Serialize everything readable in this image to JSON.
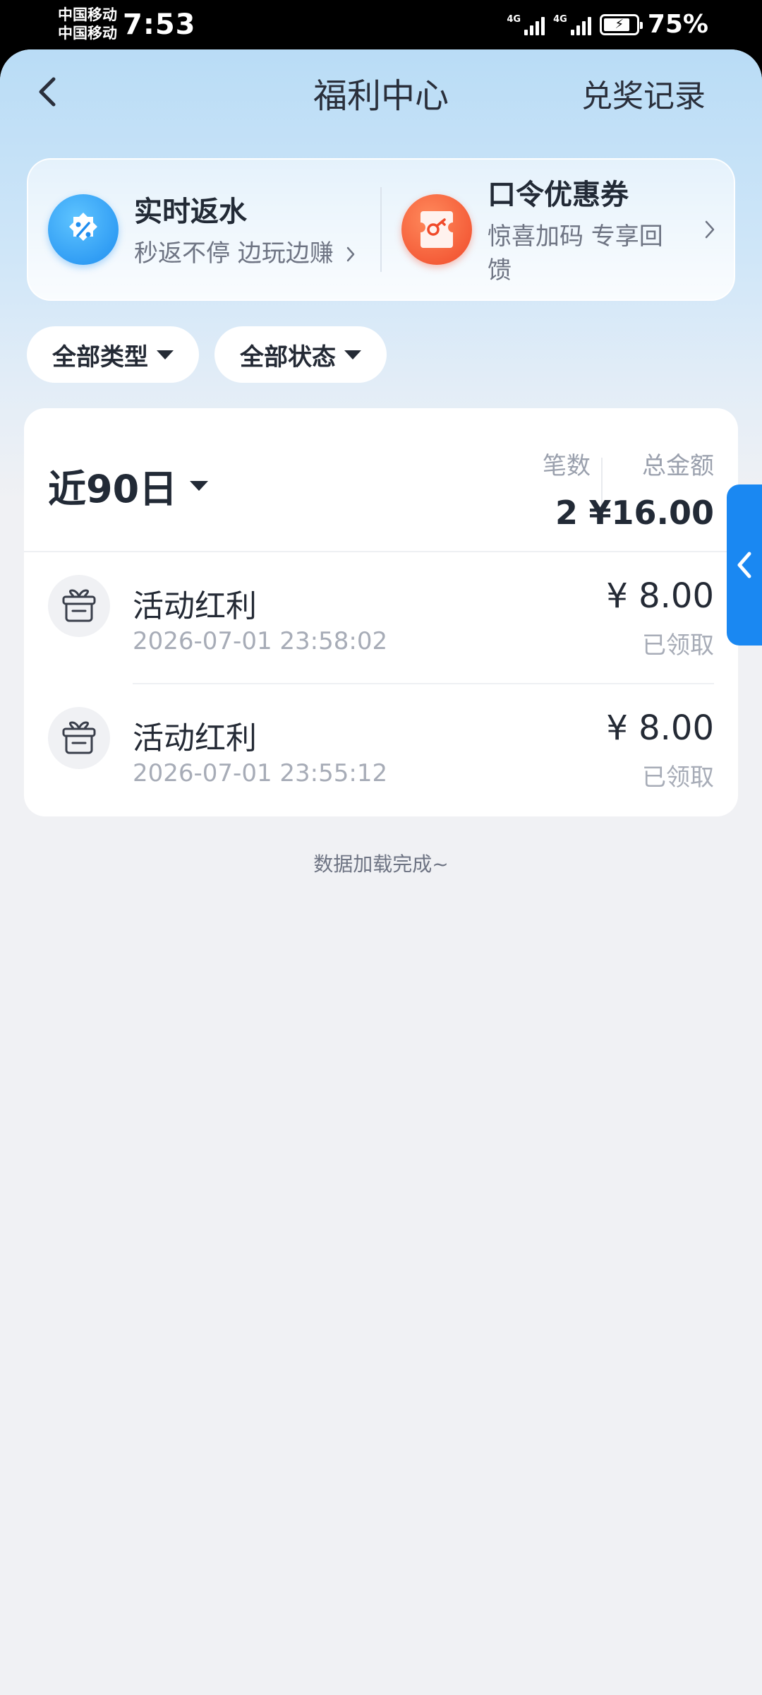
{
  "status_bar": {
    "carrier_1": "中国移动",
    "carrier_2": "中国移动",
    "time": "7:53",
    "network_1": "4G",
    "network_2": "4G",
    "battery_percent": "75%"
  },
  "header": {
    "title": "福利中心",
    "right_action": "兑奖记录"
  },
  "promos": [
    {
      "title": "实时返水",
      "subtitle": "秒返不停 边玩边赚",
      "icon": "percent-badge-icon"
    },
    {
      "title": "口令优惠券",
      "subtitle": "惊喜加码 专享回馈",
      "icon": "coupon-ticket-icon"
    }
  ],
  "filters": {
    "type": "全部类型",
    "status": "全部状态"
  },
  "summary": {
    "period": "近90日",
    "count_label": "笔数",
    "count_value": "2",
    "total_label": "总金额",
    "total_value": "¥16.00"
  },
  "records": [
    {
      "title": "活动红利",
      "time": "2026-07-01 23:58:02",
      "amount": "¥ 8.00",
      "status": "已领取"
    },
    {
      "title": "活动红利",
      "time": "2026-07-01 23:55:12",
      "amount": "¥ 8.00",
      "status": "已领取"
    }
  ],
  "footer": {
    "load_status": "数据加载完成~"
  },
  "colors": {
    "accent_blue": "#1a88f2",
    "coupon_red": "#f04a2a",
    "text_primary": "#242a35",
    "text_secondary": "#a7acb7",
    "page_bg": "#f0f1f4"
  }
}
